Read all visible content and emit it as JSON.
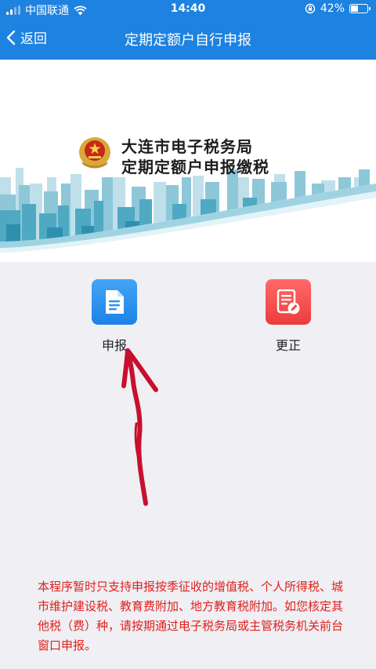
{
  "status_bar": {
    "carrier": "中国联通",
    "time": "14:40",
    "battery_percent": "42%",
    "battery_level": 0.42
  },
  "nav": {
    "back_label": "返回",
    "title": "定期定额户自行申报"
  },
  "banner": {
    "line1": "大连市电子税务局",
    "line2": "定期定额户申报缴税"
  },
  "actions": [
    {
      "label": "申报",
      "icon": "document-icon",
      "color": "#2b8ef0"
    },
    {
      "label": "更正",
      "icon": "edit-document-icon",
      "color": "#f24a4a"
    }
  ],
  "notice": "本程序暂时只支持申报按季征收的增值税、个人所得税、城市维护建设税、教育费附加、地方教育税附加。如您核定其他税（费）种，请按期通过电子税务局或主管税务机关前台窗口申报。",
  "colors": {
    "nav_bar": "#1d82e0",
    "page_bg": "#efeff4",
    "notice_text": "#e0201b",
    "annotation": "#c8102e"
  }
}
